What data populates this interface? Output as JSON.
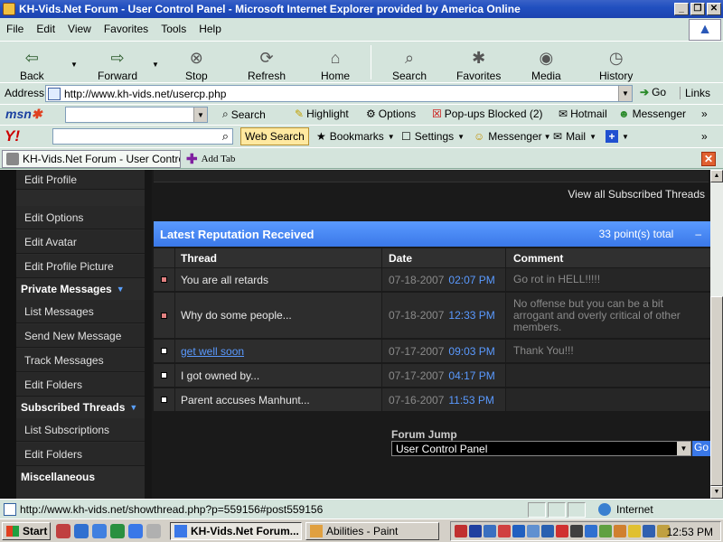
{
  "window": {
    "title": "KH-Vids.Net Forum - User Control Panel - Microsoft Internet Explorer provided by America Online",
    "buttons": [
      "_",
      "❐",
      "✕"
    ]
  },
  "menu": [
    "File",
    "Edit",
    "View",
    "Favorites",
    "Tools",
    "Help"
  ],
  "toolbar": {
    "back": "Back",
    "forward": "Forward",
    "stop": "Stop",
    "refresh": "Refresh",
    "home": "Home",
    "search": "Search",
    "favorites": "Favorites",
    "media": "Media",
    "history": "History"
  },
  "address": {
    "label": "Address",
    "url": "http://www.kh-vids.net/usercp.php",
    "go": "Go",
    "links": "Links"
  },
  "msn": {
    "logo_a": "msn",
    "logo_b": "✱",
    "search": "Search",
    "highlight": "Highlight",
    "options": "Options",
    "popups": "Pop-ups Blocked (2)",
    "hotmail": "Hotmail",
    "messenger": "Messenger"
  },
  "yahoo": {
    "logo": "Y!",
    "web_search": "Web Search",
    "bookmarks": "Bookmarks",
    "settings": "Settings",
    "messenger": "Messenger",
    "mail": "Mail"
  },
  "tabs": {
    "active_tab": "KH-Vids.Net Forum - User Control P",
    "add_tab": "Add Tab"
  },
  "sidebar": {
    "items_top": [
      "Edit Profile",
      "Edit Options",
      "Edit Avatar",
      "Edit Profile Picture"
    ],
    "private_messages_head": "Private Messages",
    "private_messages": [
      "List Messages",
      "Send New Message",
      "Track Messages",
      "Edit Folders"
    ],
    "subscribed_head": "Subscribed Threads",
    "subscribed": [
      "List Subscriptions",
      "Edit Folders"
    ],
    "misc_head": "Miscellaneous"
  },
  "main": {
    "view_subscribed": "View all Subscribed Threads",
    "rep_title": "Latest Reputation Received",
    "rep_total": "33 point(s) total",
    "rep_collapse": "–",
    "columns": {
      "thread": "Thread",
      "date": "Date",
      "comment": "Comment"
    },
    "rows": [
      {
        "thread": "You are all retards",
        "date": "07-18-2007",
        "time": "02:07 PM",
        "comment": "Go rot in HELL!!!!!",
        "color": "#e08080",
        "link": false
      },
      {
        "thread": "Why do some people...",
        "date": "07-18-2007",
        "time": "12:33 PM",
        "comment": "No offense but you can be a bit arrogant and overly critical of other members.",
        "color": "#e08080",
        "link": false
      },
      {
        "thread": "get well soon",
        "date": "07-17-2007",
        "time": "09:03 PM",
        "comment": "Thank You!!!",
        "color": "#ffffff",
        "link": true
      },
      {
        "thread": "I got owned by...",
        "date": "07-17-2007",
        "time": "04:17 PM",
        "comment": "",
        "color": "#ffffff",
        "link": false
      },
      {
        "thread": "Parent accuses Manhunt...",
        "date": "07-16-2007",
        "time": "11:53 PM",
        "comment": "",
        "color": "#ffffff",
        "link": false
      }
    ],
    "forum_jump_label": "Forum Jump",
    "forum_jump_value": "User Control Panel",
    "forum_jump_go": "Go"
  },
  "status": {
    "text": "http://www.kh-vids.net/showthread.php?p=559156#post559156",
    "zone": "Internet"
  },
  "taskbar": {
    "start": "Start",
    "task1": "KH-Vids.Net Forum...",
    "task2": "Abilities - Paint",
    "clock": "12:53 PM"
  },
  "colors": {
    "accent": "#3a78e8",
    "link": "#5a9aff",
    "chrome": "#d4e4dc"
  }
}
